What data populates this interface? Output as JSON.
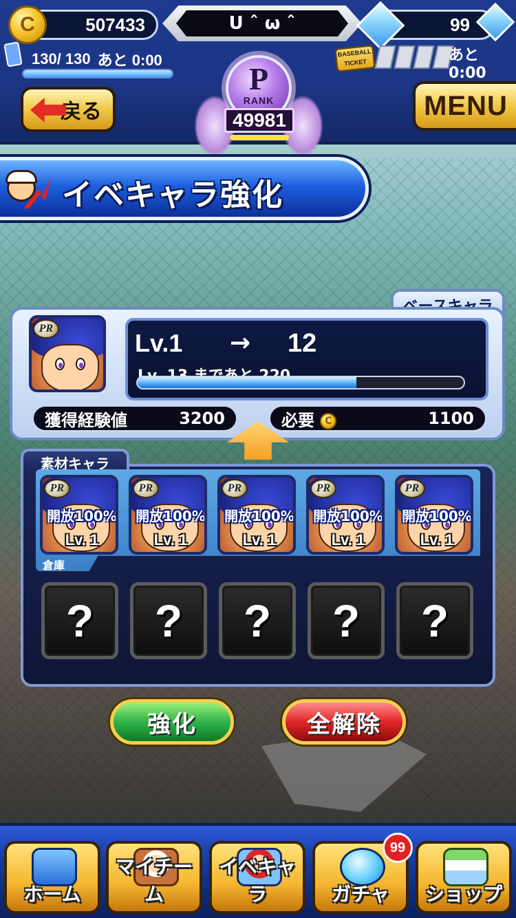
{
  "header": {
    "coins": "507433",
    "player_name": "U ˆ ω ˆ",
    "gems": "99",
    "stamina": "130/ 130",
    "stamina_recover": "あと  0:00",
    "ticket_label": "BASEBALL TICKET",
    "ticket_recover": "あと  0:00",
    "rank_letter": "P",
    "rank_label": "RANK",
    "rank_points": "49981",
    "back_label": "戻る",
    "menu_label": "MENU"
  },
  "title": "イベキャラ強化",
  "base": {
    "tab_label": "ベースキャラ",
    "pr_label": "PR",
    "level_from": "Lv.1",
    "arrow": "→",
    "level_to": "12",
    "next_level_text": "Lv. 13  まであと 220",
    "exp_progress": 0.67,
    "exp_label": "獲得経験値",
    "exp_value": "3200",
    "cost_label": "必要",
    "cost_value": "1100"
  },
  "materials": {
    "tab_label": "素材キャラ",
    "storage_label": "倉庫",
    "cards": [
      {
        "pr": "PR",
        "open": "開放100%",
        "level": "Lv. 1"
      },
      {
        "pr": "PR",
        "open": "開放100%",
        "level": "Lv. 1"
      },
      {
        "pr": "PR",
        "open": "開放100%",
        "level": "Lv. 1"
      },
      {
        "pr": "PR",
        "open": "開放100%",
        "level": "Lv. 1"
      },
      {
        "pr": "PR",
        "open": "開放100%",
        "level": "Lv. 1"
      }
    ],
    "empty_slots": [
      "?",
      "?",
      "?",
      "?",
      "?"
    ]
  },
  "actions": {
    "enhance": "強化",
    "clear_all": "全解除"
  },
  "nav": {
    "items": [
      {
        "label": "ホーム",
        "icon": "home-book-icon"
      },
      {
        "label": "マイチーム",
        "icon": "my-team-icon"
      },
      {
        "label": "イベキャラ",
        "icon": "event-character-icon"
      },
      {
        "label": "ガチャ",
        "icon": "gacha-capsule-icon"
      },
      {
        "label": "ショップ",
        "icon": "shop-store-icon"
      }
    ],
    "gacha_badge": "99"
  }
}
